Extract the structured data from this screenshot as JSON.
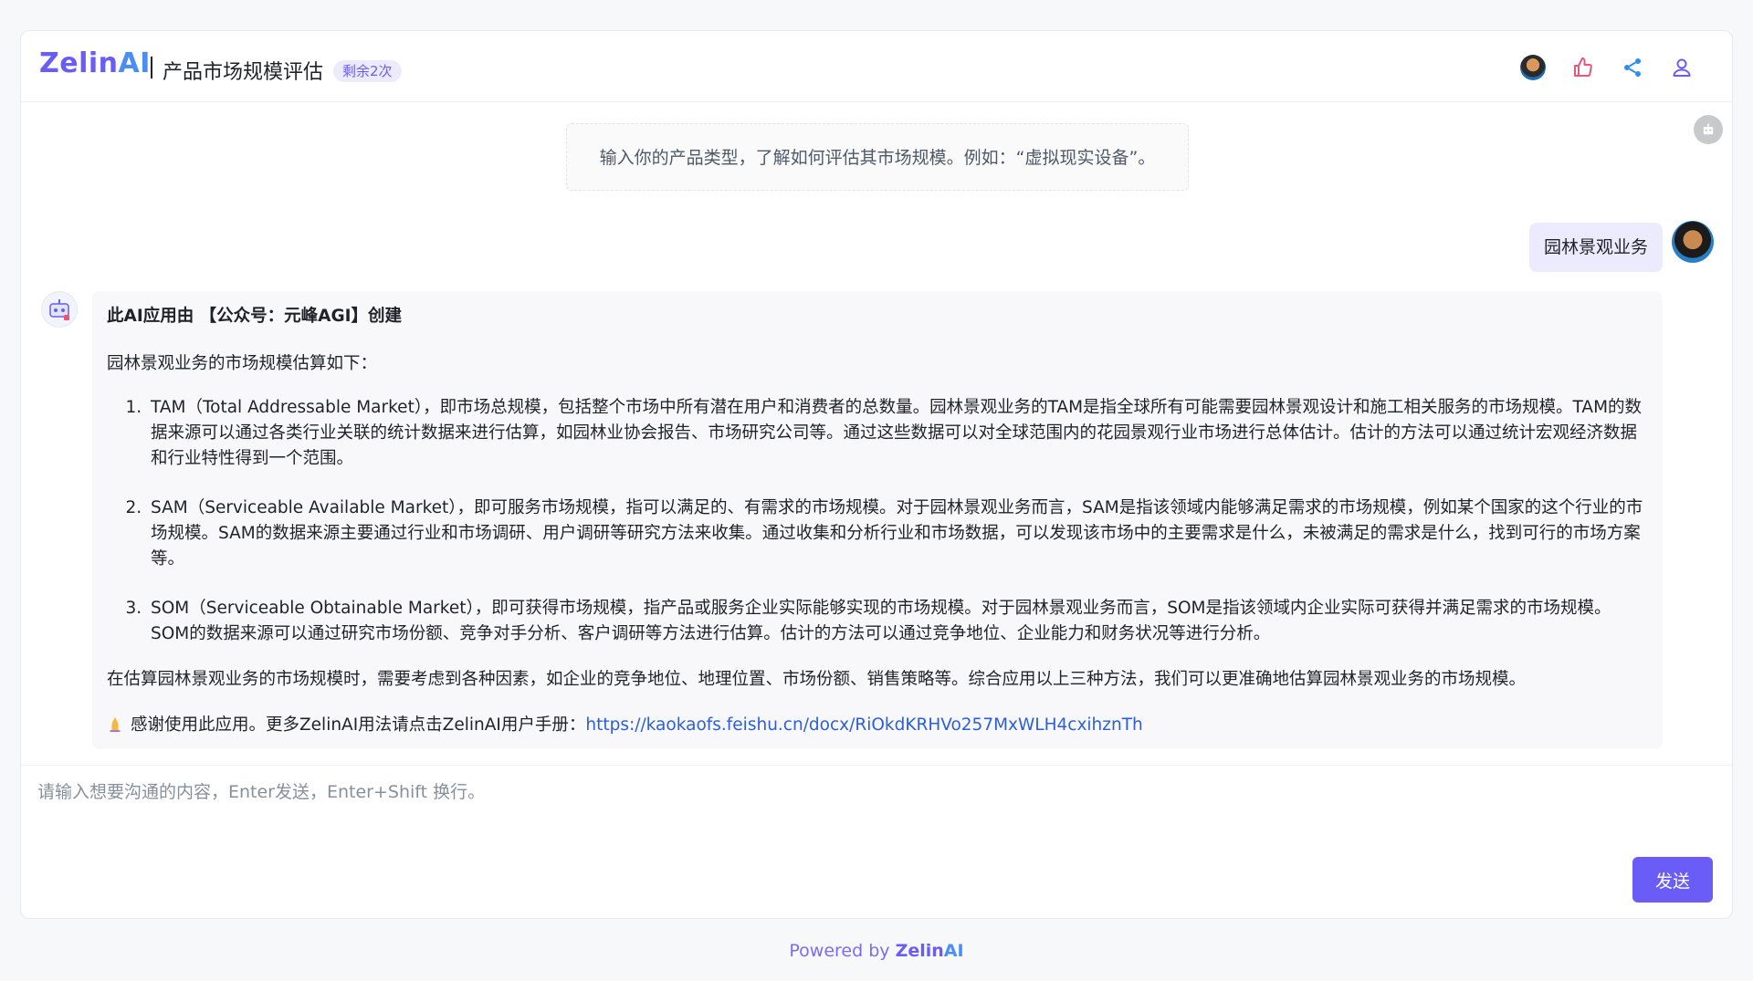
{
  "header": {
    "logo_main": "Zelin",
    "logo_ai": "AI",
    "title": "产品市场规模评估",
    "badge": "剩余2次"
  },
  "intro_text": "输入你的产品类型，了解如何评估其市场规模。例如：“虚拟现实设备”。",
  "user_message": "园林景观业务",
  "answer": {
    "creator_line": "此AI应用由 【公众号：元峰AGI】创建",
    "lead": "园林景观业务的市场规模估算如下：",
    "items": [
      "TAM（Total Addressable Market），即市场总规模，包括整个市场中所有潜在用户和消费者的总数量。园林景观业务的TAM是指全球所有可能需要园林景观设计和施工相关服务的市场规模。TAM的数据来源可以通过各类行业关联的统计数据来进行估算，如园林业协会报告、市场研究公司等。通过这些数据可以对全球范围内的花园景观行业市场进行总体估计。估计的方法可以通过统计宏观经济数据和行业特性得到一个范围。",
      "SAM（Serviceable Available Market），即可服务市场规模，指可以满足的、有需求的市场规模。对于园林景观业务而言，SAM是指该领域内能够满足需求的市场规模，例如某个国家的这个行业的市场规模。SAM的数据来源主要通过行业和市场调研、用户调研等研究方法来收集。通过收集和分析行业和市场数据，可以发现该市场中的主要需求是什么，未被满足的需求是什么，找到可行的市场方案等。",
      "SOM（Serviceable Obtainable Market），即可获得市场规模，指产品或服务企业实际能够实现的市场规模。对于园林景观业务而言，SOM是指该领域内企业实际可获得并满足需求的市场规模。SOM的数据来源可以通过研究市场份额、竞争对手分析、客户调研等方法进行估算。估计的方法可以通过竞争地位、企业能力和财务状况等进行分析。"
    ],
    "summary": "在估算园林景观业务的市场规模时，需要考虑到各种因素，如企业的竞争地位、地理位置、市场份额、销售策略等。综合应用以上三种方法，我们可以更准确地估算园林景观业务的市场规模。",
    "thanks_text": "感谢使用此应用。更多ZelinAI用法请点击ZelinAI用户手册：",
    "thanks_link": "https://kaokaofs.feishu.cn/docx/RiOkdKRHVo257MxWLH4cxihznTh"
  },
  "input": {
    "placeholder": "请输入想要沟通的内容，Enter发送，Enter+Shift 换行。",
    "send_label": "发送"
  },
  "footer": {
    "powered_prefix": "Powered by ",
    "brand_main": "Zelin",
    "brand_ai": "AI"
  },
  "icons": {
    "header": [
      "user-avatar-icon",
      "thumbs-up-icon",
      "share-icon",
      "user-icon"
    ],
    "robot": "robot-icon"
  },
  "colors": {
    "accent": "#6a5cf6",
    "accent_light": "#ecebfd",
    "link": "#2b5fd9",
    "thumbs_up": "#e8567a",
    "share": "#2e8df2",
    "user_icon": "#6a5cf6"
  }
}
